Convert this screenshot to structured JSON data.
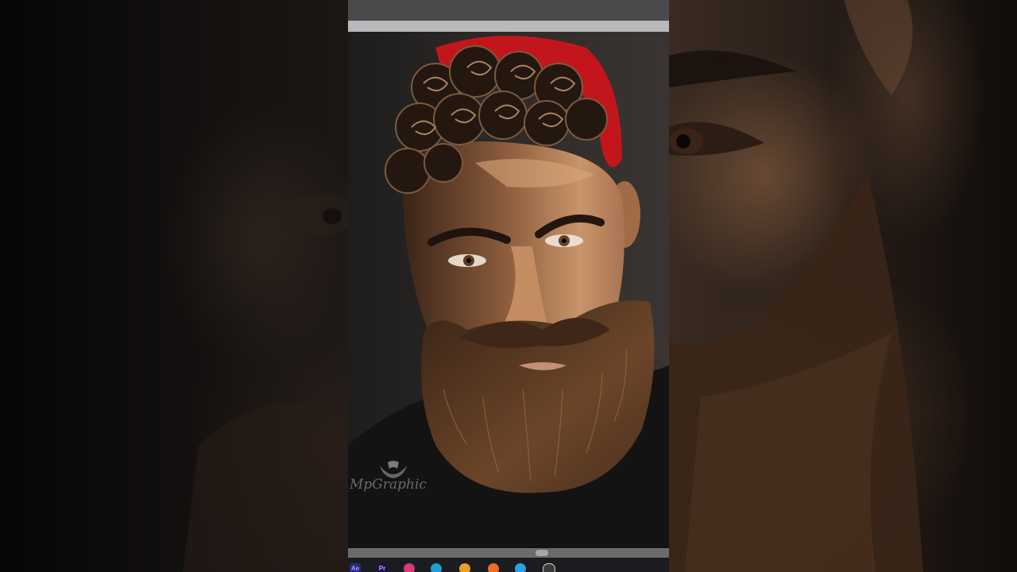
{
  "watermark": {
    "text": "MpGraphic",
    "icon": "eagle-logo-icon"
  },
  "taskbar": {
    "apps": [
      {
        "label": "Ae",
        "icon": "after-effects-icon",
        "color": "#2a2a7a",
        "text_color": "#9b9bff"
      },
      {
        "label": "Pr",
        "icon": "premiere-pro-icon",
        "color": "#1f1140",
        "text_color": "#b8a2ff"
      },
      {
        "label": "",
        "icon": "grammarly-icon",
        "color": "#d83a7a"
      },
      {
        "label": "",
        "icon": "edge-icon",
        "color": "#1f9ed4"
      },
      {
        "label": "",
        "icon": "chrome-icon",
        "color": "#e8a02a"
      },
      {
        "label": "",
        "icon": "firefox-icon",
        "color": "#f06a2a"
      },
      {
        "label": "",
        "icon": "telegram-icon",
        "color": "#2aa3e0"
      },
      {
        "label": "",
        "icon": "obs-icon",
        "color": "#3b3b3b"
      }
    ]
  },
  "colors": {
    "bandana": "#c2161c",
    "skin": "#b4805a",
    "beard": "#5a3a22",
    "hair": "#2a1a12"
  }
}
